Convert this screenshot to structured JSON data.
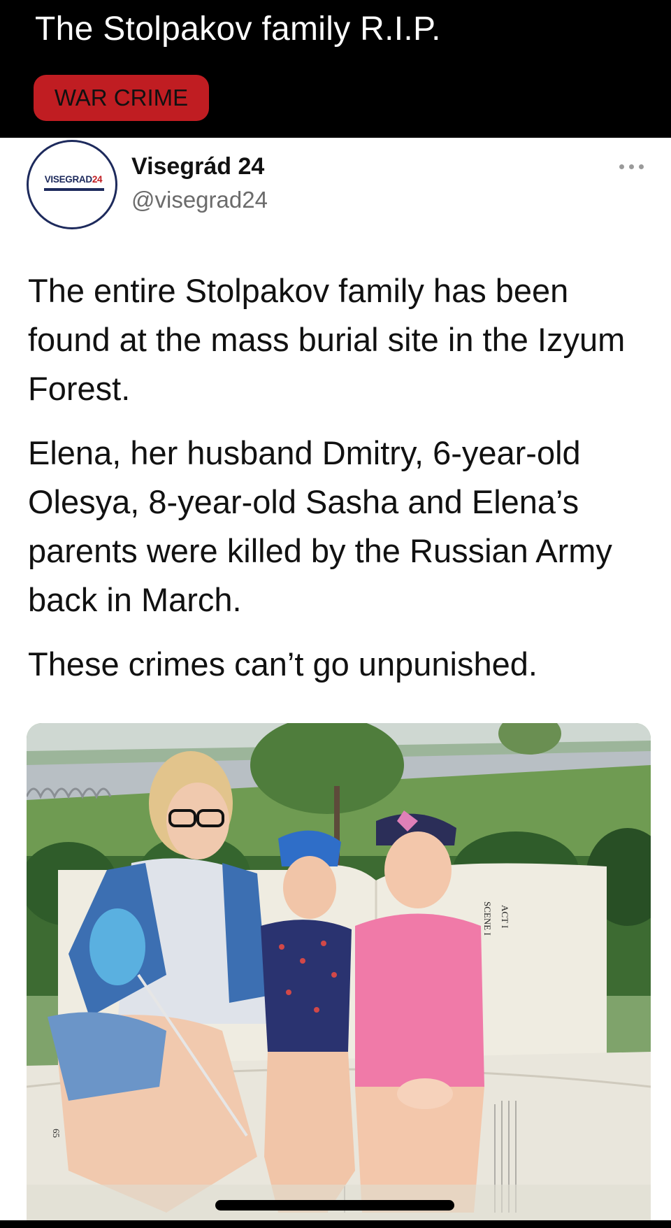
{
  "post": {
    "title": "The Stolpakov family R.I.P.",
    "flair": "WAR CRIME",
    "flair_color": "#c01d22"
  },
  "tweet": {
    "avatar": {
      "logo_text_main": "VISEGRAD",
      "logo_text_accent": "24"
    },
    "display_name": "Visegrád 24",
    "handle": "@visegrad24",
    "more_icon": "more-horizontal-icon",
    "paragraphs": [
      "The entire Stolpakov family has been found at the mass burial site in the Izyum Forest.",
      "Elena, her husband Dmitry, 6-year-old Olesya, 8-year-old Sasha and Elena’s parents were killed by the Russian Army back in March.",
      "These crimes can’t go unpunished."
    ],
    "photo": {
      "book_text": {
        "act": "ACT I",
        "scene": "SCENE I",
        "page_number": "65"
      }
    }
  },
  "colors": {
    "background": "#000000",
    "tweet_background": "#ffffff",
    "text": "#111111",
    "handle": "#6b6b6b",
    "logo_navy": "#1d2a5c"
  }
}
